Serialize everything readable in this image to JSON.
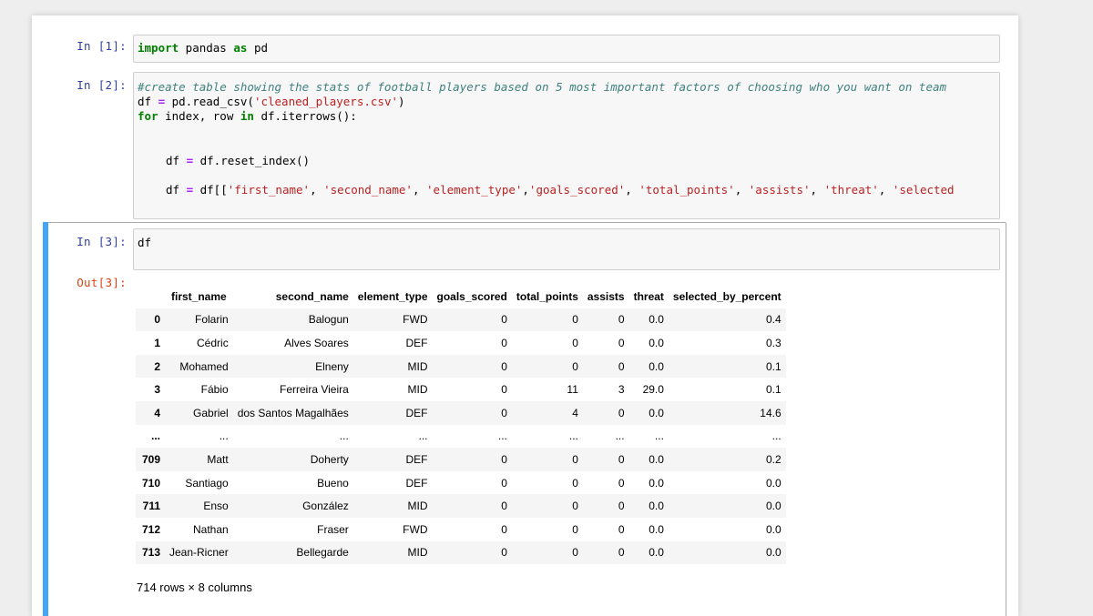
{
  "cells": [
    {
      "prompt": "In [1]:",
      "code": [
        "import pandas as pd"
      ]
    },
    {
      "prompt": "In [2]:",
      "code": [
        "#create table showing the stats of football players based on 5 most important factors of choosing who you want on team",
        "df = pd.read_csv('cleaned_players.csv')",
        "for index, row in df.iterrows():",
        "df = df.reset_index()",
        "df = df[['first_name', 'second_name', 'element_type','goals_scored', 'total_points', 'assists', 'threat', 'selected"
      ]
    },
    {
      "prompt": "In [3]:",
      "code": [
        "df"
      ],
      "out_prompt": "Out[3]:"
    }
  ],
  "dataframe": {
    "columns": [
      "first_name",
      "second_name",
      "element_type",
      "goals_scored",
      "total_points",
      "assists",
      "threat",
      "selected_by_percent"
    ],
    "rows": [
      {
        "index": "0",
        "cells": [
          "Folarin",
          "Balogun",
          "FWD",
          "0",
          "0",
          "0",
          "0.0",
          "0.4"
        ]
      },
      {
        "index": "1",
        "cells": [
          "Cédric",
          "Alves Soares",
          "DEF",
          "0",
          "0",
          "0",
          "0.0",
          "0.3"
        ]
      },
      {
        "index": "2",
        "cells": [
          "Mohamed",
          "Elneny",
          "MID",
          "0",
          "0",
          "0",
          "0.0",
          "0.1"
        ]
      },
      {
        "index": "3",
        "cells": [
          "Fábio",
          "Ferreira Vieira",
          "MID",
          "0",
          "11",
          "3",
          "29.0",
          "0.1"
        ]
      },
      {
        "index": "4",
        "cells": [
          "Gabriel",
          "dos Santos Magalhães",
          "DEF",
          "0",
          "4",
          "0",
          "0.0",
          "14.6"
        ]
      },
      {
        "index": "...",
        "cells": [
          "...",
          "...",
          "...",
          "...",
          "...",
          "...",
          "...",
          "..."
        ]
      },
      {
        "index": "709",
        "cells": [
          "Matt",
          "Doherty",
          "DEF",
          "0",
          "0",
          "0",
          "0.0",
          "0.2"
        ]
      },
      {
        "index": "710",
        "cells": [
          "Santiago",
          "Bueno",
          "DEF",
          "0",
          "0",
          "0",
          "0.0",
          "0.0"
        ]
      },
      {
        "index": "711",
        "cells": [
          "Enso",
          "González",
          "MID",
          "0",
          "0",
          "0",
          "0.0",
          "0.0"
        ]
      },
      {
        "index": "712",
        "cells": [
          "Nathan",
          "Fraser",
          "FWD",
          "0",
          "0",
          "0",
          "0.0",
          "0.0"
        ]
      },
      {
        "index": "713",
        "cells": [
          "Jean-Ricner",
          "Bellegarde",
          "MID",
          "0",
          "0",
          "0",
          "0.0",
          "0.0"
        ]
      }
    ],
    "shape_text": "714 rows × 8 columns"
  },
  "colors": {
    "input_prompt": "#303f9f",
    "output_prompt": "#d84315",
    "keyword": "#008000",
    "string": "#ba2121",
    "comment": "#408080",
    "selected_cell": "#42a5f5"
  }
}
